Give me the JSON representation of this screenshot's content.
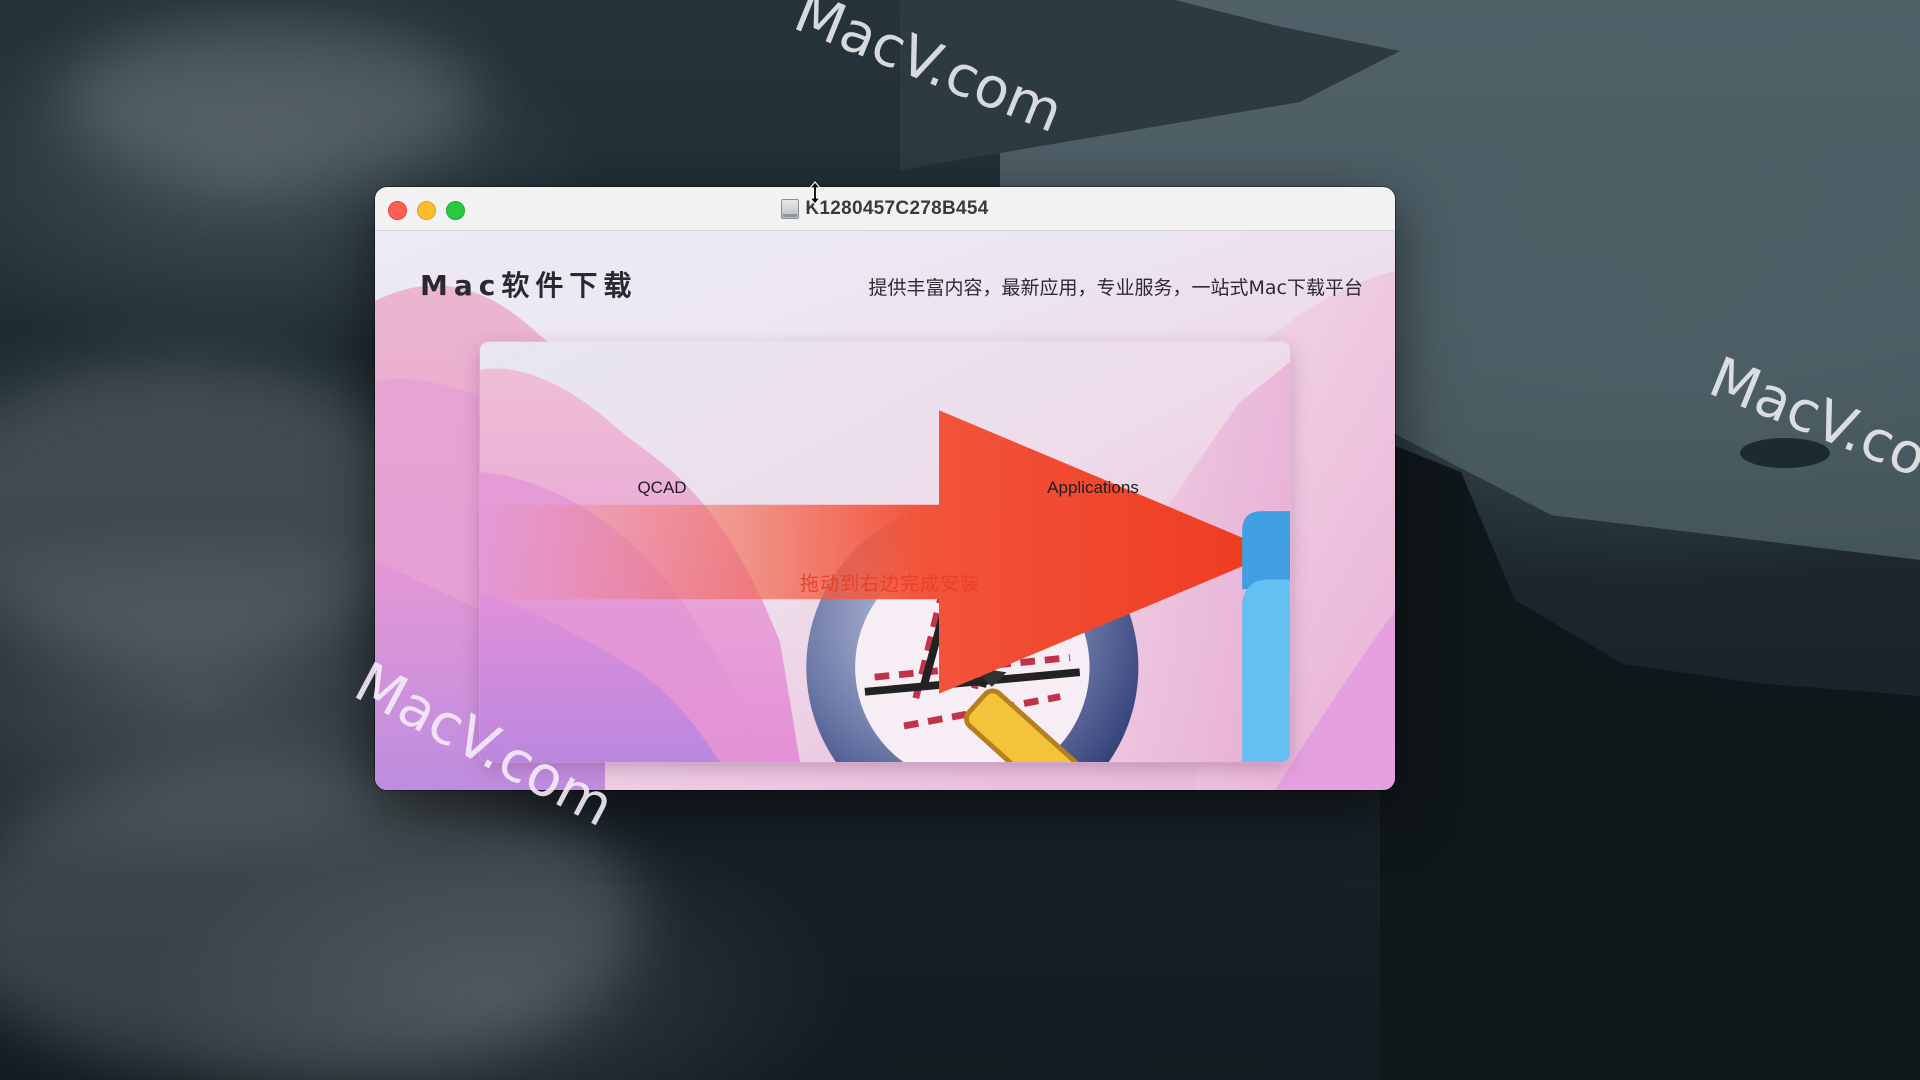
{
  "desktop": {
    "watermarks": [
      "MacV.com",
      "MacV.com",
      "MacV.com"
    ]
  },
  "window": {
    "title": "K1280457C278B454",
    "title_icon": "disk-image-icon",
    "controls": {
      "close": "close-button",
      "minimize": "minimize-button",
      "zoom": "zoom-button"
    },
    "colors": {
      "close": "#fe5f57",
      "minimize": "#febc2e",
      "zoom": "#28c840"
    }
  },
  "header": {
    "brand": "Mac软件下载",
    "tagline": "提供丰富内容，最新应用，专业服务，一站式Mac下载平台"
  },
  "installer": {
    "source_app": {
      "label": "QCAD",
      "icon": "qcad-app-icon"
    },
    "instruction": "拖动到右边完成安装",
    "instruction_color": "#e8402a",
    "arrow_icon": "arrow-right-icon",
    "target": {
      "label": "Applications",
      "icon": "applications-folder-icon",
      "alias": true
    }
  }
}
